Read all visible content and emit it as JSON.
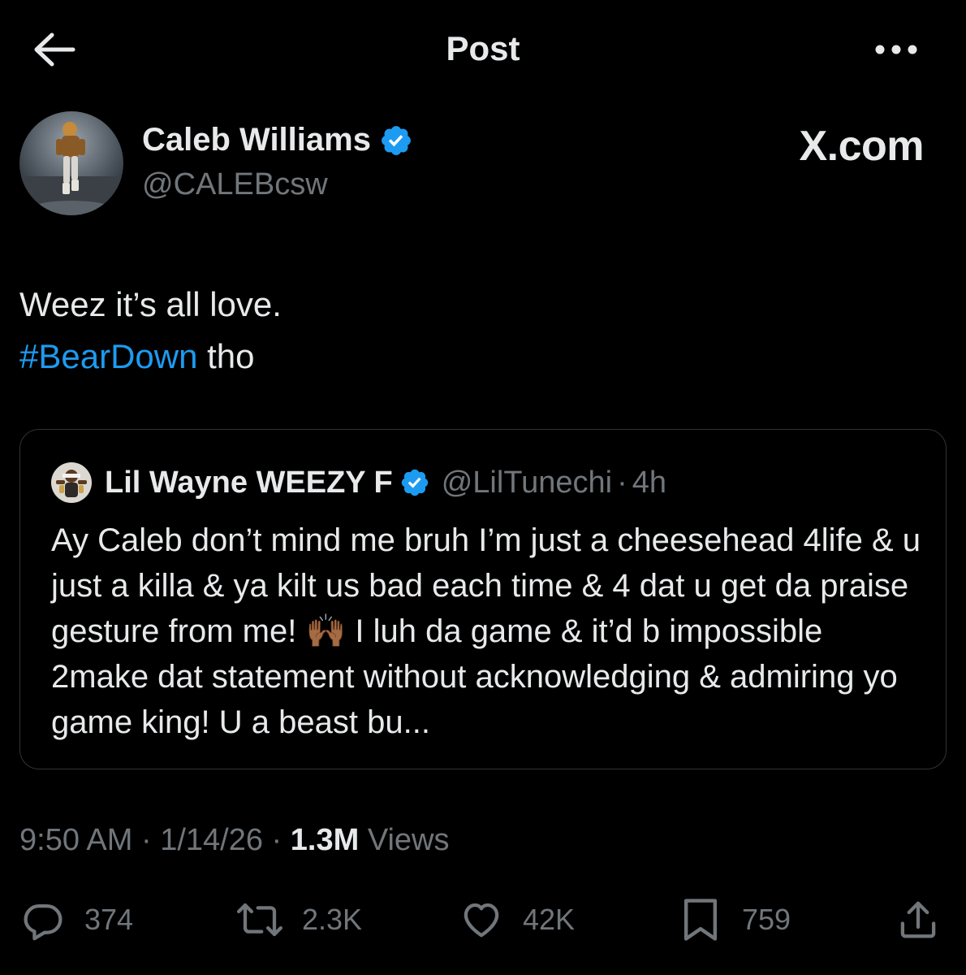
{
  "header": {
    "title": "Post",
    "back_icon": "arrow-left-icon",
    "more_icon": "more-horizontal-icon"
  },
  "author": {
    "name": "Caleb Williams",
    "handle": "@CALEBcsw",
    "verified": true
  },
  "brand": {
    "label": "X.com"
  },
  "post": {
    "line1": "Weez it’s all love.",
    "hashtag": "#BearDown",
    "line2_rest": " tho"
  },
  "quote": {
    "name": "Lil Wayne WEEZY F",
    "handle": "@LilTunechi",
    "separator": "·",
    "time": "4h",
    "text_before_emoji": "Ay Caleb don’t mind me bruh I’m just a cheesehead 4life & u just a killa & ya kilt us bad each time & 4 dat u get da praise gesture from me! ",
    "emoji": "🙌🏾",
    "text_after_emoji": " I luh da game & it’d b impossible 2make dat statement without acknowledging & admiring yo game king! U a beast bu..."
  },
  "meta": {
    "time": "9:50 AM",
    "sep": " · ",
    "date": "1/14/26",
    "views_count": "1.3M",
    "views_label": " Views"
  },
  "actions": {
    "replies": "374",
    "reposts": "2.3K",
    "likes": "42K",
    "bookmarks": "759"
  },
  "colors": {
    "background": "#000000",
    "text": "#e7e9ea",
    "secondary": "#71767b",
    "accent": "#1d9bf0",
    "border": "#2f3336"
  }
}
